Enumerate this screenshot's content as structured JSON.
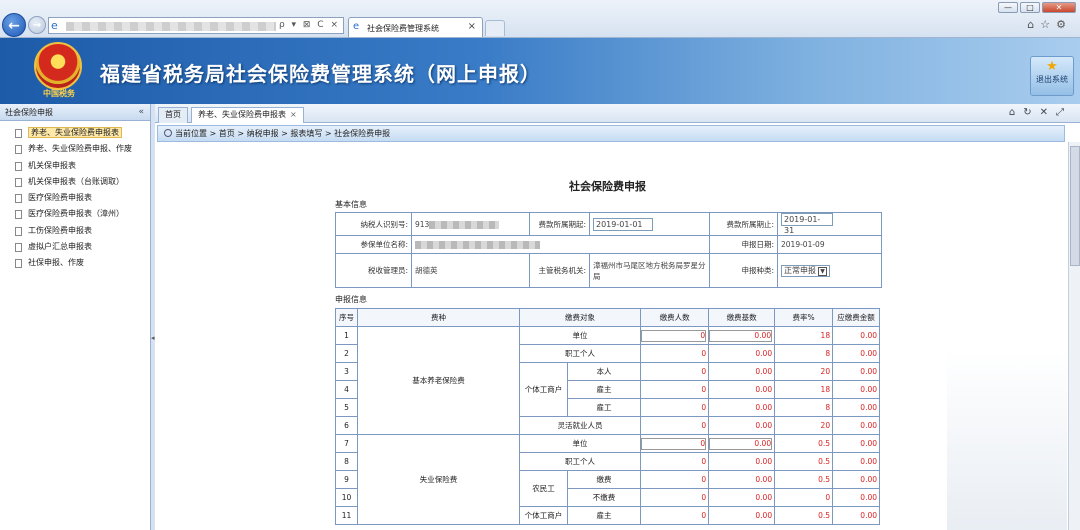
{
  "browser": {
    "tab_title": "社会保险费管理系统",
    "tab_close": "×",
    "addr_controls": "ρ ▾ ⊠ C ×",
    "win_min": "—",
    "win_max": "□",
    "win_close": "✕"
  },
  "header": {
    "emblem_text": "中国税务",
    "title": "福建省税务局社会保险费管理系统（网上申报）",
    "exit_label": "退出系统"
  },
  "sidebar": {
    "title": "社会保险申报",
    "collapse": "«",
    "items": [
      {
        "label": "养老、失业保险费申报表"
      },
      {
        "label": "养老、失业保险费申报、作废"
      },
      {
        "label": "机关保申报表"
      },
      {
        "label": "机关保申报表（台账调取）"
      },
      {
        "label": "医疗保险费申报表"
      },
      {
        "label": "医疗保险费申报表（漳州）"
      },
      {
        "label": "工伤保险费申报表"
      },
      {
        "label": "虚拟户汇总申报表"
      },
      {
        "label": "社保申报、作废"
      }
    ]
  },
  "tabs": {
    "home": "首页",
    "current": "养老、失业保险费申报表",
    "close": "×"
  },
  "breadcrumb": "当前位置 > 首页 > 纳税申报 > 报表填写 > 社会保险费申报",
  "form": {
    "title": "社会保险费申报",
    "basic_label": "基本信息",
    "declare_label": "申报信息",
    "taxpayer_id_label": "纳税人识别号:",
    "taxpayer_id_value": "913",
    "period_start_label": "费款所属期起:",
    "period_start": "2019-01-01",
    "period_end_label": "费款所属期止:",
    "period_end": "2019-01-31",
    "unit_name_label": "参保单位名称:",
    "declare_date_label": "申报日期:",
    "declare_date": "2019-01-09",
    "manager_label": "税收管理员:",
    "manager_value": "胡德英",
    "authority_label": "主管税务机关:",
    "authority_value": "漳福州市马尾区地方税务局罗星分局",
    "declare_type_label": "申报种类:",
    "declare_type": "正常申报"
  },
  "grid": {
    "headers": [
      "序号",
      "费种",
      "缴费对象",
      "缴费人数",
      "缴费基数",
      "费率%",
      "应缴费金额"
    ],
    "group1": "基本养老保险费",
    "group2": "失业保险费",
    "obj_unit": "单位",
    "obj_worker": "职工个人",
    "obj_individual": "个体工商户",
    "obj_self": "本人",
    "obj_employer": "雇主",
    "obj_employee": "雇工",
    "obj_flexible": "灵活就业人员",
    "obj_farmer": "农民工",
    "obj_pay": "缴费",
    "obj_nopay": "不缴费",
    "rows": [
      {
        "no": "1",
        "count": "0",
        "base": "0.00",
        "rate": "18",
        "amount": "0.00"
      },
      {
        "no": "2",
        "count": "0",
        "base": "0.00",
        "rate": "8",
        "amount": "0.00"
      },
      {
        "no": "3",
        "count": "0",
        "base": "0.00",
        "rate": "20",
        "amount": "0.00"
      },
      {
        "no": "4",
        "count": "0",
        "base": "0.00",
        "rate": "18",
        "amount": "0.00"
      },
      {
        "no": "5",
        "count": "0",
        "base": "0.00",
        "rate": "8",
        "amount": "0.00"
      },
      {
        "no": "6",
        "count": "0",
        "base": "0.00",
        "rate": "20",
        "amount": "0.00"
      },
      {
        "no": "7",
        "count": "0",
        "base": "0.00",
        "rate": "0.5",
        "amount": "0.00"
      },
      {
        "no": "8",
        "count": "0",
        "base": "0.00",
        "rate": "0.5",
        "amount": "0.00"
      },
      {
        "no": "9",
        "count": "0",
        "base": "0.00",
        "rate": "0.5",
        "amount": "0.00"
      },
      {
        "no": "10",
        "count": "0",
        "base": "0.00",
        "rate": "0",
        "amount": "0.00"
      },
      {
        "no": "11",
        "count": "0",
        "base": "0.00",
        "rate": "0.5",
        "amount": "0.00"
      }
    ]
  },
  "colors": {
    "header_blue": "#1d5ba8",
    "value_red": "#d22",
    "border": "#7c98c0"
  },
  "icons": [
    "back-arrow-icon",
    "forward-arrow-icon",
    "ie-icon",
    "home-icon",
    "star-icon",
    "gear-icon",
    "refresh-icon",
    "close-icon",
    "fullscreen-icon",
    "exit-icon",
    "document-icon"
  ]
}
